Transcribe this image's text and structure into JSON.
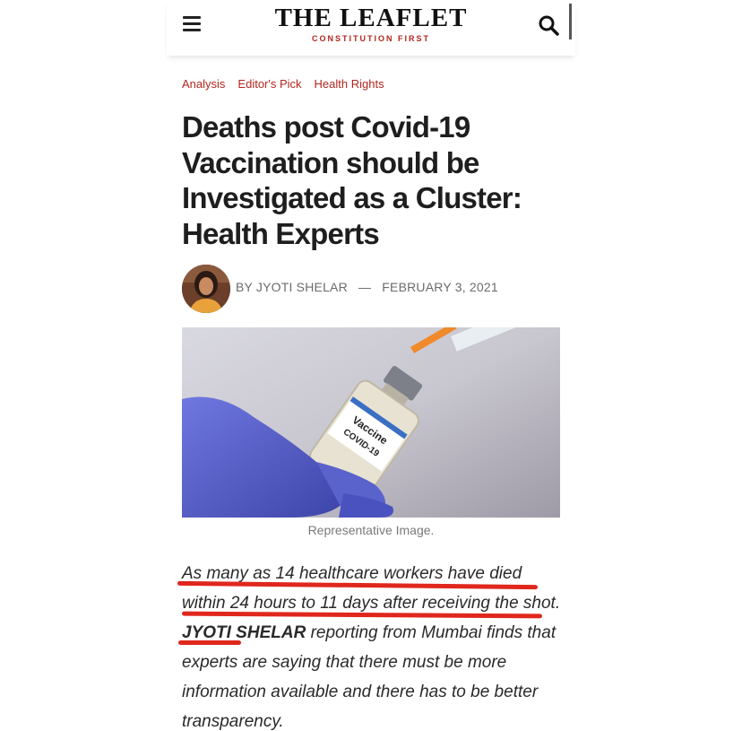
{
  "header": {
    "logo_title": "THE LEAFLET",
    "logo_tagline": "CONSTITUTION FIRST",
    "menu_icon": "hamburger-menu-icon",
    "search_icon": "search-icon"
  },
  "categories": [
    "Analysis",
    "Editor's Pick",
    "Health Rights"
  ],
  "article": {
    "title": "Deaths post Covid-19 Vaccination should be Investigated as a Cluster: Health Experts",
    "byline_prefix": "BY",
    "author": "JYOTI SHELAR",
    "separator": "—",
    "date": "FEBRUARY 3, 2021",
    "image_caption": "Representative Image.",
    "image_label_line1": "Vaccine",
    "image_label_line2": "COVID-19",
    "lead_part1": "As many as 14 healthcare workers have died within 24 hours to 11 days after receiving the shot.",
    "lead_author": "JYOTI SHELAR",
    "lead_part2": "reporting from Mumbai finds that experts are saying that there must be more information available and there has to be better transparency."
  },
  "colors": {
    "accent": "#b3261e",
    "highlight_underline": "#e0271d",
    "glove": "#5560d0"
  }
}
